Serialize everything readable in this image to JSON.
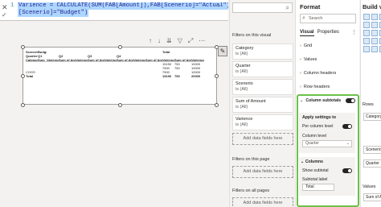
{
  "formula": {
    "line_number": "1",
    "line1": "Varience = CALCULATE(SUM(FAB[Amount]),FAB[Scenerio]=\"Actual\")-CALCULATE(SUM(FAB[Amount]),FAB",
    "line2": "[Scenerio]=\"Budget\")"
  },
  "matrix": {
    "row1": [
      "Scenerio",
      "Budget",
      "",
      "",
      "",
      "",
      "",
      "",
      "",
      "",
      "Total",
      "",
      ""
    ],
    "row2": [
      "Quarter",
      "Q1",
      "",
      "Q2",
      "",
      "Q3",
      "",
      "Q4",
      "",
      "",
      "",
      "",
      ""
    ],
    "row3": [
      "Category",
      "Sum",
      "Varience",
      "Sum of Amount",
      "Varience",
      "Sum of Amount",
      "Varience",
      "Sum of Amount",
      "Varience",
      "Sum of Amount",
      "Varience",
      "Sum of Amount",
      "Varience"
    ],
    "data_rows": [
      [
        "",
        "",
        "",
        "",
        "",
        "",
        "",
        "",
        "",
        "",
        "15150",
        "750",
        "10000"
      ],
      [
        "",
        "",
        "",
        "",
        "",
        "",
        "",
        "",
        "",
        "",
        "7500",
        "750",
        "10000"
      ],
      [
        "COGS",
        "",
        "",
        "",
        "",
        "",
        "",
        "",
        "",
        "",
        "7500",
        "",
        "10000"
      ]
    ],
    "total_row": [
      "Total",
      "",
      "",
      "",
      "",
      "",
      "",
      "",
      "",
      "",
      "15150",
      "750",
      "20000"
    ]
  },
  "filters": {
    "search_icon": "search-icon",
    "on_visual": "Filters on this visual",
    "cards": [
      {
        "name": "Category",
        "value": "is (All)"
      },
      {
        "name": "Quarter",
        "value": "is (All)"
      },
      {
        "name": "Scenerio",
        "value": "is (All)"
      },
      {
        "name": "Sum of Amount",
        "value": "is (All)"
      },
      {
        "name": "Varience",
        "value": "is (All)"
      }
    ],
    "add_label": "Add data fields here",
    "on_page": "Filters on this page",
    "on_all": "Filters on all pages"
  },
  "format": {
    "title": "Format",
    "search_placeholder": "Search",
    "tabs": [
      "Visual",
      "Properties"
    ],
    "sections": [
      "Grid",
      "Values",
      "Column headers",
      "Row headers"
    ],
    "subtotals": {
      "title": "Column subtotals",
      "apply_label": "Apply settings to",
      "per_level": "Per column level",
      "column_level_label": "Column level",
      "column_level_value": "Quarter",
      "columns_title": "Columns",
      "show_subtotal": "Show subtotal",
      "subtotal_label": "Subtotal label",
      "subtotal_value": "Total"
    }
  },
  "build": {
    "title": "Build vis",
    "rows_label": "Rows",
    "rows_field": "Category",
    "columns_field": "Scenerio",
    "columns_field2": "Quarter",
    "values_label": "Values",
    "values_field": "Sum of Amount"
  }
}
